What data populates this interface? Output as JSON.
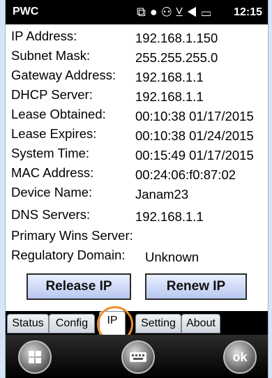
{
  "status_bar": {
    "app_title": "PWC",
    "time": "12:15",
    "icons": [
      "connection-icon",
      "circle-icon",
      "people-icon",
      "no-signal-icon",
      "volume-icon",
      "battery-icon"
    ]
  },
  "info_rows": [
    {
      "label": "IP Address:",
      "value": "192.168.1.150"
    },
    {
      "label": "Subnet Mask:",
      "value": "255.255.255.0"
    },
    {
      "label": "Gateway Address:",
      "value": "192.168.1.1"
    },
    {
      "label": "DHCP Server:",
      "value": "192.168.1.1"
    },
    {
      "label": "Lease Obtained:",
      "value": "00:10:38 01/17/2015"
    },
    {
      "label": "Lease Expires:",
      "value": "00:10:38 01/24/2015"
    },
    {
      "label": "System Time:",
      "value": "00:15:49 01/17/2015"
    },
    {
      "label": "MAC Address:",
      "value": "00:24:06:f0:87:02"
    },
    {
      "label": "Device Name:",
      "value": "Janam23"
    },
    {
      "label": "DNS Servers:",
      "value": "192.168.1.1"
    },
    {
      "label": "Primary Wins Server:",
      "value": ""
    },
    {
      "label": "Regulatory Domain:",
      "value": "Unknown"
    }
  ],
  "buttons": {
    "release": "Release IP",
    "renew": "Renew IP"
  },
  "tabs": [
    "Status",
    "Config",
    "IP",
    "Setting",
    "About"
  ],
  "active_tab": "IP",
  "bottom_bar": {
    "start_icon": "windows-logo-icon",
    "keyboard_icon": "keyboard-icon",
    "ok_label": "ok"
  },
  "colors": {
    "highlight_circle": "#f28c28",
    "button_gradient_top": "#e9f0ff",
    "button_gradient_bottom": "#b8c7f0"
  }
}
